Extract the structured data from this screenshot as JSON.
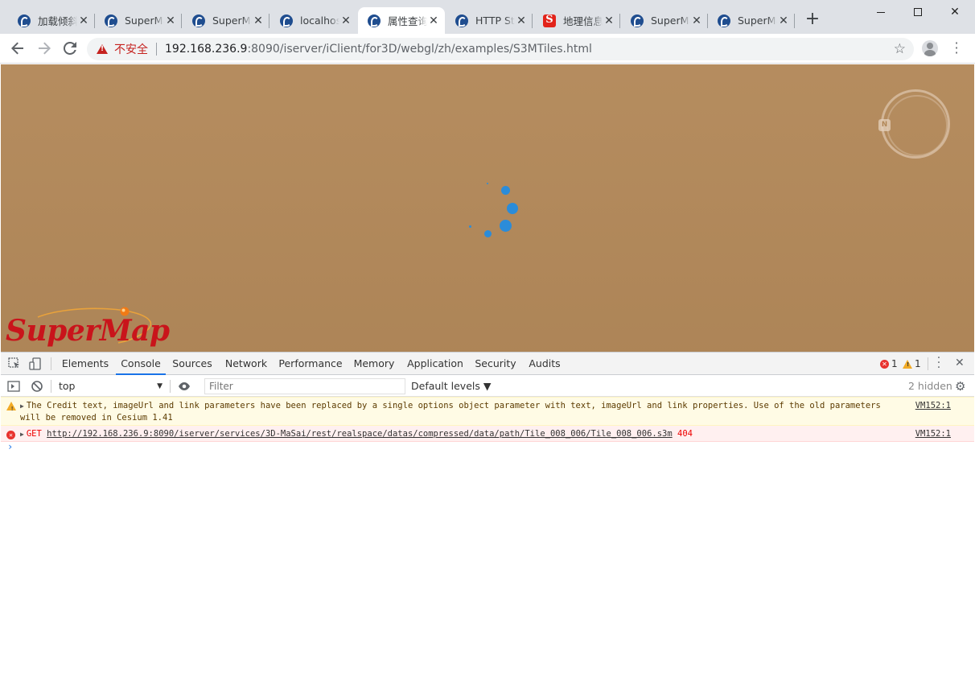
{
  "window": {
    "tabs": [
      {
        "title": "加载倾斜摄影",
        "favicon": "supermap-icon"
      },
      {
        "title": "SuperMap",
        "favicon": "supermap-icon"
      },
      {
        "title": "SuperMap",
        "favicon": "supermap-icon"
      },
      {
        "title": "localhost",
        "favicon": "supermap-icon"
      },
      {
        "title": "属性查询",
        "favicon": "supermap-icon",
        "active": true
      },
      {
        "title": "HTTP Status",
        "favicon": "supermap-icon"
      },
      {
        "title": "地理信息",
        "favicon": "s-logo-icon"
      },
      {
        "title": "SuperMap",
        "favicon": "supermap-icon"
      },
      {
        "title": "SuperMap",
        "favicon": "supermap-icon"
      }
    ],
    "close_glyph": "✕",
    "new_tab_glyph": "+"
  },
  "toolbar": {
    "security_label": "不安全",
    "url_host": "192.168.236.9",
    "url_rest": ":8090/iserver/iClient/for3D/webgl/zh/examples/S3MTiles.html"
  },
  "viewport": {
    "background": "#b3895a",
    "compass_letter": "N",
    "logo_text": "SuperMap",
    "spinner_color": "#2b8cd9"
  },
  "devtools": {
    "tabs": [
      "Elements",
      "Console",
      "Sources",
      "Network",
      "Performance",
      "Memory",
      "Application",
      "Security",
      "Audits"
    ],
    "active_tab": "Console",
    "error_count": "1",
    "warning_count": "1",
    "context": "top",
    "filter_placeholder": "Filter",
    "levels_label": "Default levels ▼",
    "hidden_label": "2 hidden",
    "messages": [
      {
        "level": "warning",
        "text": "The Credit text, imageUrl and link parameters have been replaced by a single options object parameter with text, imageUrl and link properties. Use of the old parameters will be removed in Cesium 1.41",
        "source": "VM152:1"
      },
      {
        "level": "error",
        "method": "GET",
        "url": "http://192.168.236.9:8090/iserver/services/3D-MaSai/rest/realspace/datas/compressed/data/path/Tile_008_006/Tile_008_006.s3m",
        "status": "404",
        "source": "VM152:1"
      }
    ],
    "prompt": "›"
  }
}
